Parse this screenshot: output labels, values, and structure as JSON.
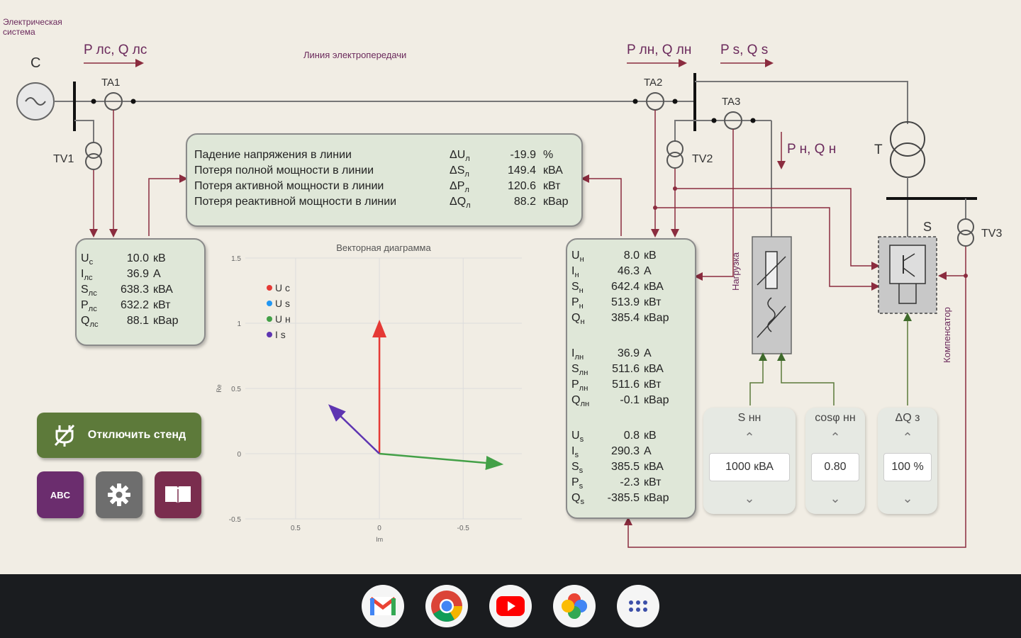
{
  "scheme": {
    "system_label": "Электрическая\nсистема",
    "system_letter": "C",
    "line_label": "Линия электропередачи",
    "flow_ls": "P лс, Q лс",
    "flow_ln": "P лн, Q лн",
    "flow_s": "P s, Q s",
    "flow_n": "P н, Q н",
    "ta1": "TA1",
    "ta2": "TA2",
    "ta3": "TA3",
    "tv1": "TV1",
    "tv2": "TV2",
    "tv3": "TV3",
    "t": "T",
    "s": "S",
    "load_label": "Нагрузка",
    "comp_label": "Компенсатор"
  },
  "losses": {
    "rows": [
      {
        "name": "Падение напряжения в линии",
        "sym": "ΔU",
        "sub": "л",
        "value": "-19.9",
        "unit": "%"
      },
      {
        "name": "Потеря полной мощности в линии",
        "sym": "ΔS",
        "sub": "л",
        "value": "149.4",
        "unit": "кВА"
      },
      {
        "name": "Потеря активной мощности в линии",
        "sym": "ΔP",
        "sub": "л",
        "value": "120.6",
        "unit": "кВт"
      },
      {
        "name": "Потеря реактивной мощности в линии",
        "sym": "ΔQ",
        "sub": "л",
        "value": "88.2",
        "unit": "кВар"
      }
    ]
  },
  "source_meas": {
    "rows": [
      {
        "sym": "U",
        "sub": "с",
        "value": "10.0",
        "unit": "кВ"
      },
      {
        "sym": "I",
        "sub": "лс",
        "value": "36.9",
        "unit": "А"
      },
      {
        "sym": "S",
        "sub": "лс",
        "value": "638.3",
        "unit": "кВА"
      },
      {
        "sym": "P",
        "sub": "лс",
        "value": "632.2",
        "unit": "кВт"
      },
      {
        "sym": "Q",
        "sub": "лс",
        "value": "88.1",
        "unit": "кВар"
      }
    ]
  },
  "load_meas": {
    "rows": [
      {
        "sym": "U",
        "sub": "н",
        "value": "8.0",
        "unit": "кВ"
      },
      {
        "sym": "I",
        "sub": "н",
        "value": "46.3",
        "unit": "А"
      },
      {
        "sym": "S",
        "sub": "н",
        "value": "642.4",
        "unit": "кВА"
      },
      {
        "sym": "P",
        "sub": "н",
        "value": "513.9",
        "unit": "кВт"
      },
      {
        "sym": "Q",
        "sub": "н",
        "value": "385.4",
        "unit": "кВар"
      },
      {
        "sym": "I",
        "sub": "лн",
        "value": "36.9",
        "unit": "А"
      },
      {
        "sym": "S",
        "sub": "лн",
        "value": "511.6",
        "unit": "кВА"
      },
      {
        "sym": "P",
        "sub": "лн",
        "value": "511.6",
        "unit": "кВт"
      },
      {
        "sym": "Q",
        "sub": "лн",
        "value": "-0.1",
        "unit": "кВар"
      },
      {
        "sym": "U",
        "sub": "s",
        "value": "0.8",
        "unit": "кВ"
      },
      {
        "sym": "I",
        "sub": "s",
        "value": "290.3",
        "unit": "А"
      },
      {
        "sym": "S",
        "sub": "s",
        "value": "385.5",
        "unit": "кВА"
      },
      {
        "sym": "P",
        "sub": "s",
        "value": "-2.3",
        "unit": "кВт"
      },
      {
        "sym": "Q",
        "sub": "s",
        "value": "-385.5",
        "unit": "кВар"
      }
    ]
  },
  "chart_data": {
    "type": "line",
    "title": "Векторная диаграмма",
    "xlabel": "Im",
    "ylabel": "Re",
    "xlim": [
      0.8,
      -0.85
    ],
    "ylim": [
      -0.5,
      1.5
    ],
    "x_ticks": [
      "0.5",
      "0",
      "-0.5"
    ],
    "y_ticks": [
      "1.5",
      "1",
      "0.5",
      "0",
      "-0.5"
    ],
    "grid": true,
    "legend": "top-left",
    "series": [
      {
        "name": "U c",
        "color": "#e53935",
        "from": [
          0,
          0
        ],
        "to": [
          0,
          1.0
        ]
      },
      {
        "name": "U s",
        "color": "#2196f3",
        "from": [
          0,
          0
        ],
        "to": [
          0,
          0
        ]
      },
      {
        "name": "U н",
        "color": "#43a047",
        "from": [
          0,
          0
        ],
        "to": [
          -0.72,
          -0.08
        ]
      },
      {
        "name": "I s",
        "color": "#5e35b1",
        "from": [
          0,
          0
        ],
        "to": [
          0.29,
          0.36
        ]
      }
    ]
  },
  "controls": {
    "disconnect_label": "Отключить стенд",
    "abc_label": "ABC",
    "snn": {
      "title": "S нн",
      "value": "1000  кВА"
    },
    "cos": {
      "title": "cosφ нн",
      "value": "0.80"
    },
    "dq": {
      "title": "ΔQ з",
      "value": "100 %"
    }
  },
  "colors": {
    "accent_dark_red": "#8b2c3f",
    "panel_green": "#dfe7d8",
    "disconnect_btn": "#5d7a3a",
    "abc_btn": "#6b2d6e",
    "settings_btn": "#6e6e6e",
    "book_btn": "#7a2d4e"
  },
  "dock": {
    "apps": [
      "gmail-icon",
      "chrome-icon",
      "youtube-icon",
      "photos-icon",
      "apps-grid-icon"
    ]
  }
}
